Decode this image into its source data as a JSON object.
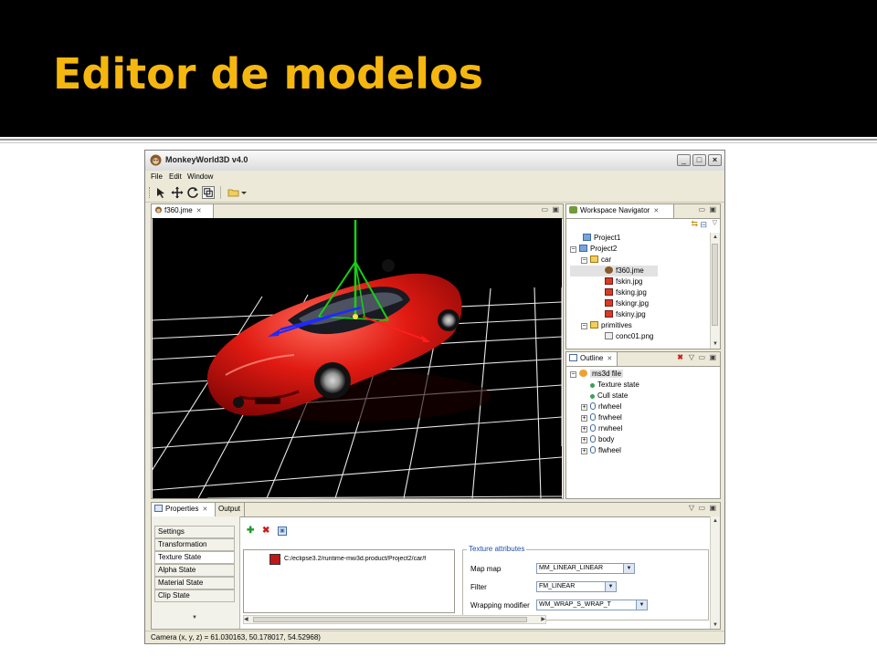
{
  "slide": {
    "title": "Editor de modelos"
  },
  "window": {
    "title": "MonkeyWorld3D v4.0",
    "minimize": "_",
    "maximize": "□",
    "close": "×"
  },
  "menu": [
    {
      "label": "File"
    },
    {
      "label": "Edit"
    },
    {
      "label": "Window"
    }
  ],
  "editor": {
    "tab_label": "f360.jme"
  },
  "navigator": {
    "tab_label": "Workspace Navigator",
    "items": [
      {
        "label": "Project1",
        "icon": "project-folder-icon"
      },
      {
        "label": "Project2",
        "icon": "project-folder-icon"
      },
      {
        "label": "car",
        "icon": "folder-icon"
      },
      {
        "label": "f360.jme",
        "icon": "model-file-icon"
      },
      {
        "label": "fskin.jpg",
        "icon": "image-file-icon"
      },
      {
        "label": "fsking.jpg",
        "icon": "image-file-icon"
      },
      {
        "label": "fskingr.jpg",
        "icon": "image-file-icon"
      },
      {
        "label": "fskiny.jpg",
        "icon": "image-file-icon"
      },
      {
        "label": "primitives",
        "icon": "folder-icon"
      },
      {
        "label": "conc01.png",
        "icon": "image-file-icon"
      }
    ]
  },
  "outline": {
    "tab_label": "Outline",
    "items": [
      {
        "label": "ms3d file"
      },
      {
        "label": "Texture state"
      },
      {
        "label": "Cull state"
      },
      {
        "label": "rlwheel"
      },
      {
        "label": "frwheel"
      },
      {
        "label": "rrwheel"
      },
      {
        "label": "body"
      },
      {
        "label": "flwheel"
      }
    ]
  },
  "properties": {
    "tabs": [
      {
        "label": "Properties"
      },
      {
        "label": "Output"
      }
    ],
    "side_tabs": [
      {
        "label": "Settings"
      },
      {
        "label": "Transformation"
      },
      {
        "label": "Texture State"
      },
      {
        "label": "Alpha State"
      },
      {
        "label": "Material State"
      },
      {
        "label": "Clip State"
      }
    ],
    "texture_path": "C:/eclipse3.2/runtime-mw3d.product/Project2/car/f",
    "group_title": "Texture attributes",
    "fields": [
      {
        "label": "Map map",
        "value": "MM_LINEAR_LINEAR"
      },
      {
        "label": "Filter",
        "value": "FM_LINEAR"
      },
      {
        "label": "Wrapping modifier",
        "value": "WM_WRAP_S_WRAP_T"
      }
    ]
  },
  "status": {
    "text": "Camera (x, y, z) = 61.030163, 50.178017, 54.52968)"
  },
  "colors": {
    "title_accent": "#f5b70f",
    "car_red": "#d81414",
    "grid": "#e8e8e8"
  }
}
